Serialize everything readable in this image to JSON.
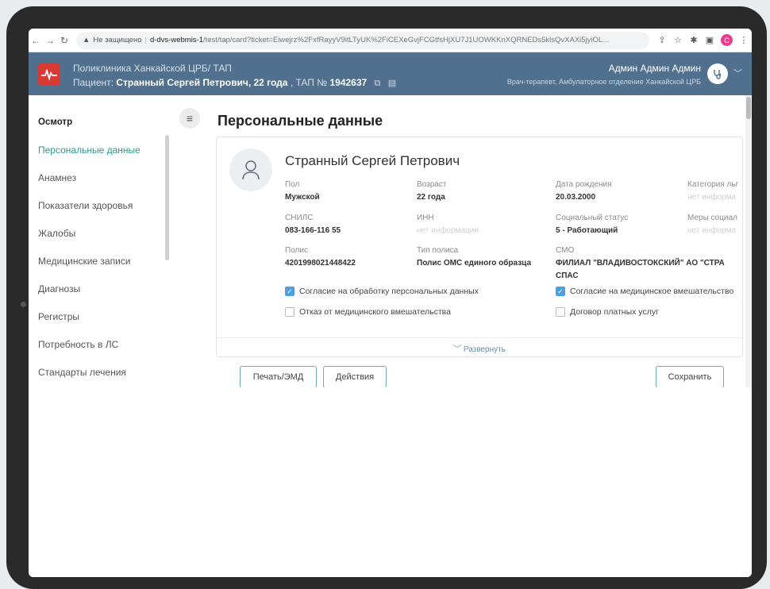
{
  "browser": {
    "security": "Не защищено",
    "host": "d-dvs-webmis-1",
    "path": "/test/tap/card?ticket=Eiwejrz%2FxfRayyV9itLTyUK%2FiCEXeGvjFCGtfsHjXU7J1UOWKKnXQRNEDs5klsQvXAXi5jyiOL...",
    "profile_letter": "C"
  },
  "header": {
    "clinic": "Поликлиника Ханкайской ЦРБ/ ТАП",
    "patient_label": "Пациент:",
    "patient_name": "Странный Сергей Петрович, 22 года",
    "tap_label": ", ТАП №",
    "tap_number": "1942637",
    "user_name": "Админ Админ Админ",
    "user_role": "Врач-терапевт, Амбулаторное отделение Ханкайской ЦРБ"
  },
  "sidebar": {
    "items": [
      {
        "label": "Осмотр"
      },
      {
        "label": "Персональные данные"
      },
      {
        "label": "Анамнез"
      },
      {
        "label": "Показатели здоровья"
      },
      {
        "label": "Жалобы"
      },
      {
        "label": "Медицинские записи"
      },
      {
        "label": "Диагнозы"
      },
      {
        "label": "Регистры"
      },
      {
        "label": "Потребность в ЛС"
      },
      {
        "label": "Стандарты лечения"
      }
    ]
  },
  "main": {
    "title": "Персональные данные",
    "full_name": "Странный Сергей Петрович",
    "fields": {
      "gender": {
        "label": "Пол",
        "value": "Мужской"
      },
      "age": {
        "label": "Возраст",
        "value": "22 года"
      },
      "birth_date": {
        "label": "Дата рождения",
        "value": "20.03.2000"
      },
      "category": {
        "label": "Категория льг",
        "value": "нет информа"
      },
      "snils": {
        "label": "СНИЛС",
        "value": "083-166-116 55"
      },
      "inn": {
        "label": "ИНН",
        "value": "нет информации"
      },
      "social_status": {
        "label": "Социальный статус",
        "value": "5 - Работающий"
      },
      "social_support": {
        "label": "Меры социал",
        "value": "нет информа"
      },
      "policy": {
        "label": "Полис",
        "value": "4201998021448422"
      },
      "policy_type": {
        "label": "Тип полиса",
        "value": "Полис ОМС единого образца"
      },
      "smo": {
        "label": "СМО",
        "value": "ФИЛИАЛ \"ВЛАДИВОСТОКСКИЙ\" АО \"СТРА",
        "value2": "СПАС"
      }
    },
    "checkboxes": {
      "consent_personal_data": {
        "label": "Согласие на обработку персональных данных",
        "checked": true
      },
      "consent_medical": {
        "label": "Согласие на медицинское вмешательство",
        "checked": true
      },
      "refusal_medical": {
        "label": "Отказ от медицинского вмешательства",
        "checked": false
      },
      "paid_services": {
        "label": "Договор платных услуг",
        "checked": false
      }
    },
    "expand_label": "Развернуть",
    "buttons": {
      "print": "Печать/ЭМД",
      "actions": "Действия",
      "save": "Сохранить"
    }
  },
  "colors": {
    "header_bg": "#51708d",
    "accent_green": "#2a9a87",
    "checkbox_blue": "#4da0dc",
    "logo_red": "#d93a33"
  }
}
